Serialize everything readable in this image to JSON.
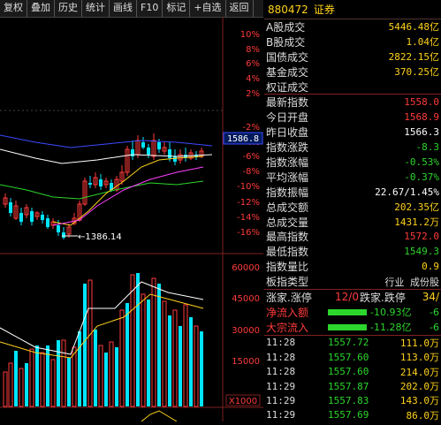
{
  "toolbar": {
    "items": [
      "复权",
      "叠加",
      "历史",
      "统计",
      "画线",
      "F10",
      "标记",
      "+自选",
      "返回"
    ]
  },
  "chart": {
    "price_axis": [
      "10%",
      "8%",
      "6%",
      "4%",
      "2%",
      "-2%",
      "-4%",
      "-6%",
      "-8%",
      "-10%",
      "-12%",
      "-14%",
      "-16%"
    ],
    "current_price": "1586.8",
    "low_label": "1386.14",
    "vol_axis": [
      "60000",
      "45000",
      "30000",
      "15000"
    ],
    "vol_unit": "X1000",
    "colors": {
      "up": "#ff3b3b",
      "down": "#00e5ff",
      "ma5": "#ffffff",
      "ma10": "#ffd21a",
      "ma20": "#ff3fff",
      "ma60": "#2cd62c",
      "ma120": "#3a4bff"
    }
  },
  "quote": {
    "code": "880472",
    "name": "证券",
    "rows": [
      {
        "label": "A股成交",
        "value": "5446.48亿",
        "color": "#ffd21a"
      },
      {
        "label": "B股成交",
        "value": "1.04亿",
        "color": "#ffd21a"
      },
      {
        "label": "国债成交",
        "value": "2822.15亿",
        "color": "#ffd21a"
      },
      {
        "label": "基金成交",
        "value": "370.25亿",
        "color": "#ffd21a"
      },
      {
        "label": "权证成交",
        "value": "",
        "color": "#ffd21a"
      }
    ],
    "rows2": [
      {
        "label": "最新指数",
        "value": "1558.0",
        "color": "#ff3b3b"
      },
      {
        "label": "今日开盘",
        "value": "1568.9",
        "color": "#ff3b3b"
      },
      {
        "label": "昨日收盘",
        "value": "1566.3",
        "color": "#ffffff"
      },
      {
        "label": "指数涨跌",
        "value": "-8.3",
        "color": "#2cd62c"
      },
      {
        "label": "指数涨幅",
        "value": "-0.53%",
        "color": "#2cd62c"
      },
      {
        "label": "平均涨幅",
        "value": "-0.37%",
        "color": "#2cd62c"
      },
      {
        "label": "指数振幅",
        "value": "22.67/1.45%",
        "color": "#ffffff"
      },
      {
        "label": "总成交额",
        "value": "202.35亿",
        "color": "#ffd21a"
      },
      {
        "label": "总成交量",
        "value": "1431.2万",
        "color": "#ffd21a"
      },
      {
        "label": "最高指数",
        "value": "1572.0",
        "color": "#ff3b3b"
      },
      {
        "label": "最低指数",
        "value": "1549.3",
        "color": "#2cd62c"
      },
      {
        "label": "指数量比",
        "value": "0.9",
        "color": "#ffd21a"
      },
      {
        "label": "板指类型",
        "value": "行业 成份股",
        "color": "#ddd"
      }
    ],
    "updown": {
      "label": "涨家.涨停",
      "mid": "12/0",
      "label2": "跌家.跌停",
      "val2": "34/"
    },
    "flows": [
      {
        "label": "净流入额",
        "value": "-10.93亿",
        "tail": "-6"
      },
      {
        "label": "大宗流入",
        "value": "-11.28亿",
        "tail": "-6"
      }
    ],
    "ticks": [
      {
        "time": "11:28",
        "price": "1557.72",
        "vol": "111.0万"
      },
      {
        "time": "11:28",
        "price": "1557.60",
        "vol": "113.0万"
      },
      {
        "time": "11:28",
        "price": "1557.60",
        "vol": "214.0万"
      },
      {
        "time": "11:29",
        "price": "1557.87",
        "vol": "202.0万"
      },
      {
        "time": "11:29",
        "price": "1557.83",
        "vol": "143.0万"
      },
      {
        "time": "11:29",
        "price": "1557.69",
        "vol": "86.0万"
      }
    ]
  }
}
